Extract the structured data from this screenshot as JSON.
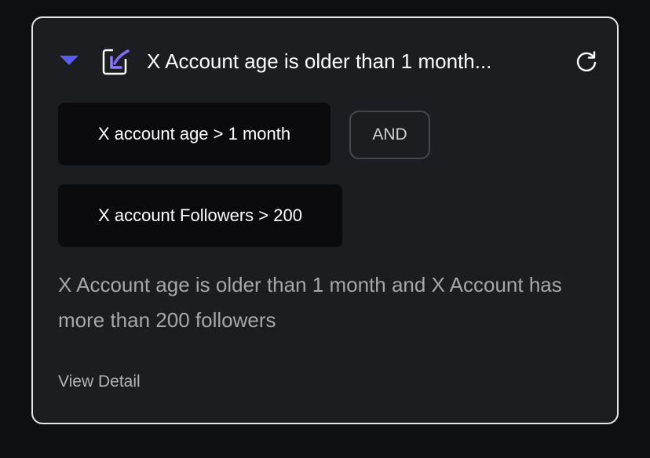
{
  "card": {
    "title": "X Account age is older than 1 month...",
    "logo_icon": "custom-logo-icon",
    "refresh_icon": "refresh-icon",
    "caret_icon": "caret-down-icon",
    "conditions": [
      {
        "label": "X account age > 1 month"
      },
      {
        "label": "X account Followers > 200"
      }
    ],
    "operator": "AND",
    "description": "X Account age is older than 1 month and X Account has more than 200 followers",
    "view_detail_label": "View Detail"
  },
  "colors": {
    "background": "#0e0f13",
    "card_bg": "#1c1d21",
    "card_border": "#e6e6e6",
    "accent": "#5b5cf0",
    "chip_bg": "#0b0b0d"
  }
}
